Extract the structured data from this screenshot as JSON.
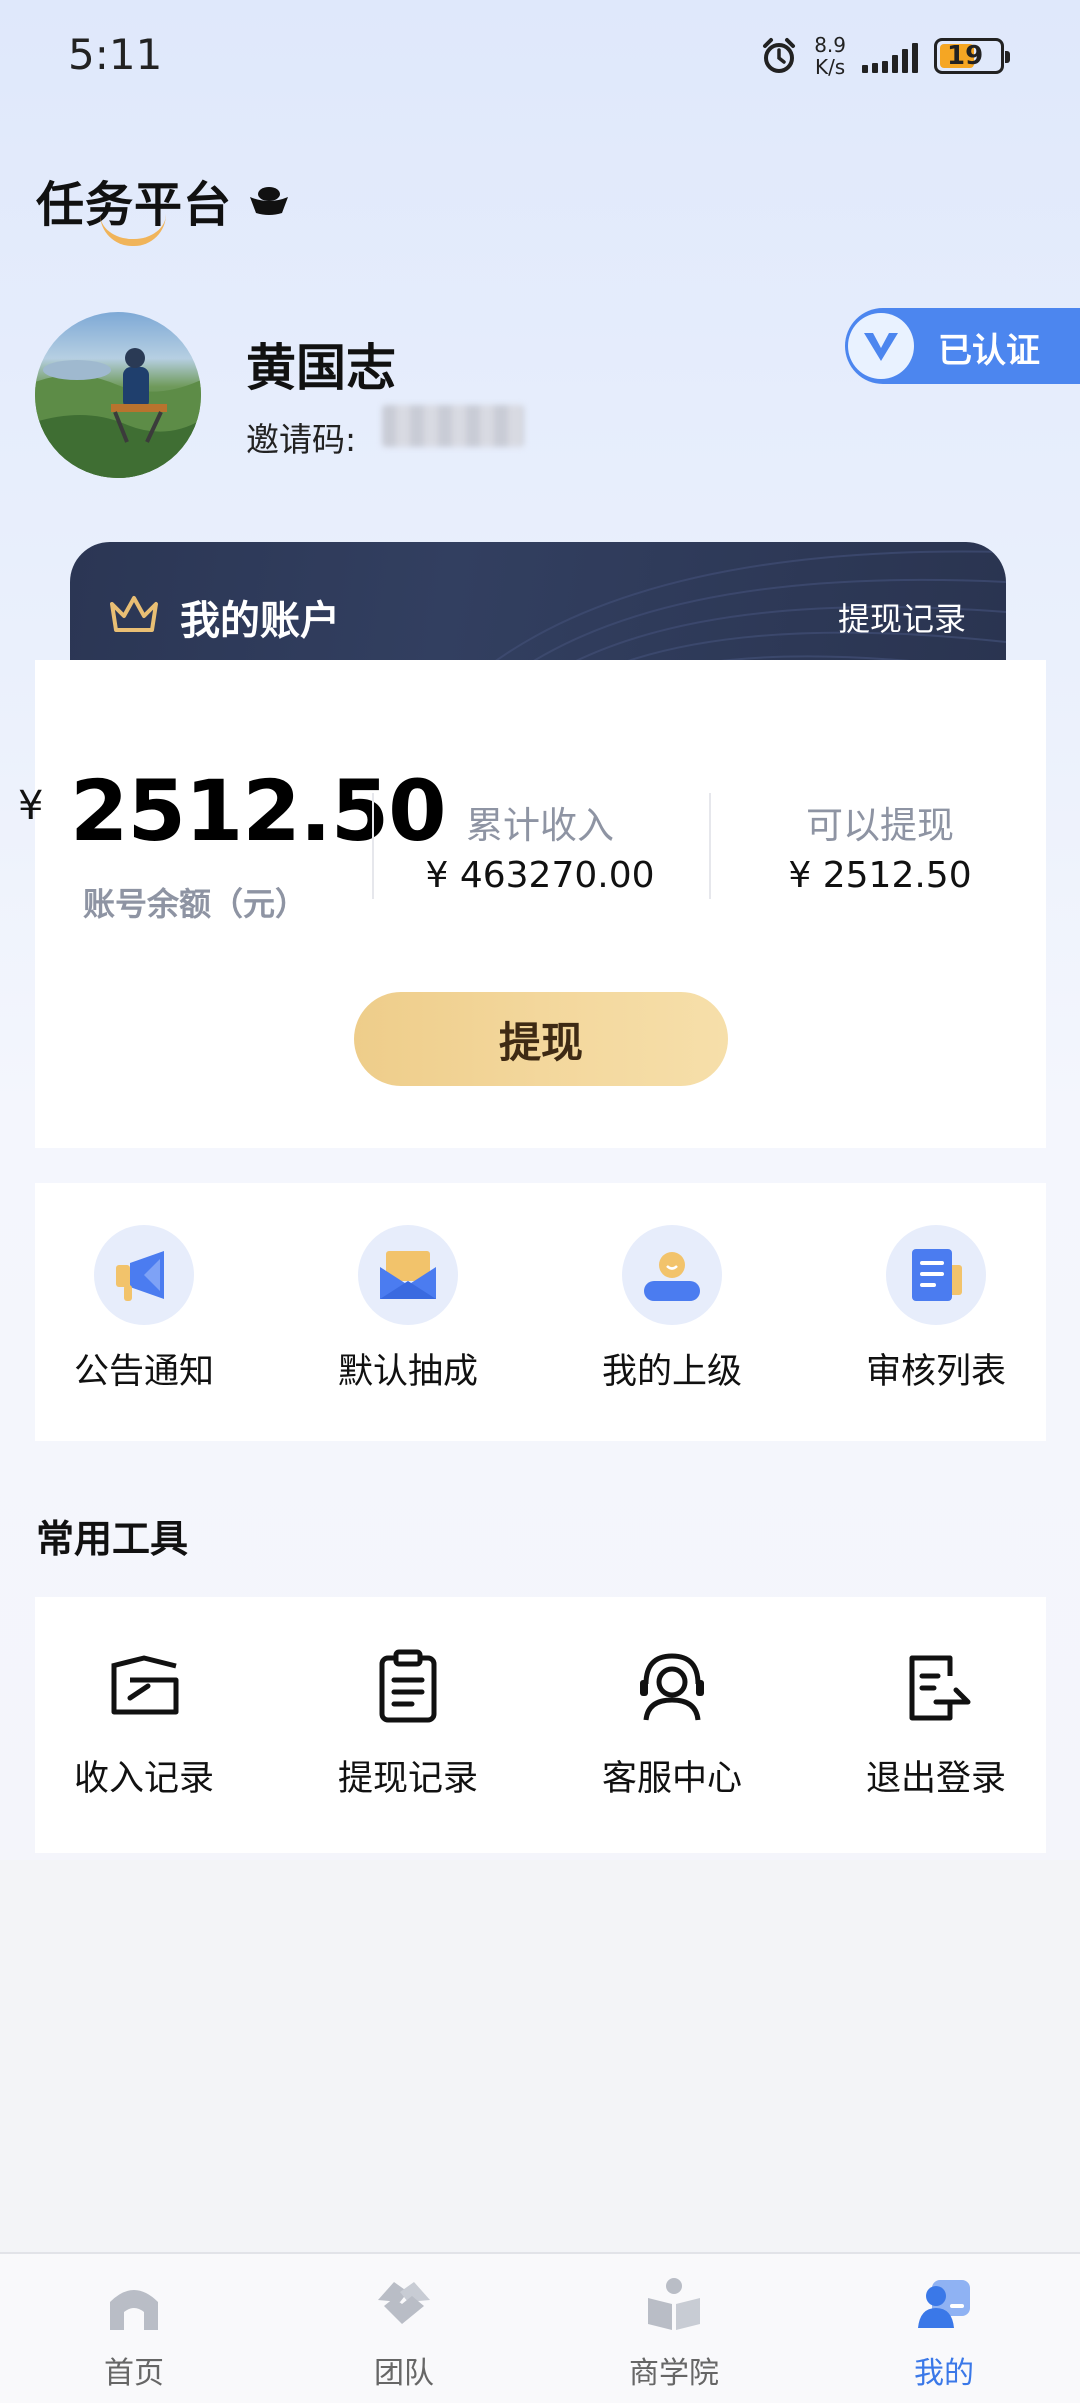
{
  "status_bar": {
    "time": "5:11",
    "net_speed_value": "8.9",
    "net_speed_unit": "K/s",
    "battery": "19",
    "icons": [
      "alarm-icon",
      "signal-icon",
      "battery-icon"
    ]
  },
  "header": {
    "logo_text": "任务平台",
    "logo_icon": "ingot-icon"
  },
  "profile": {
    "name": "黄国志",
    "invite_label": "邀请码:",
    "verified_label": "已认证"
  },
  "account": {
    "title": "我的账户",
    "history_link": "提现记录",
    "currency": "¥",
    "balance": "2512.50",
    "balance_label": "账号余额（元）",
    "total_income_label": "累计收入",
    "total_income_value": "¥ 463270.00",
    "withdrawable_label": "可以提现",
    "withdrawable_value": "¥ 2512.50",
    "withdraw_button": "提现"
  },
  "quick_actions": [
    {
      "label": "公告通知",
      "icon": "megaphone-icon"
    },
    {
      "label": "默认抽成",
      "icon": "envelope-icon"
    },
    {
      "label": "我的上级",
      "icon": "person-icon"
    },
    {
      "label": "审核列表",
      "icon": "document-icon"
    }
  ],
  "tools": {
    "title": "常用工具",
    "items": [
      {
        "label": "收入记录",
        "icon": "income-record-icon"
      },
      {
        "label": "提现记录",
        "icon": "clipboard-icon"
      },
      {
        "label": "客服中心",
        "icon": "customer-service-icon"
      },
      {
        "label": "退出登录",
        "icon": "logout-icon"
      }
    ]
  },
  "bottom_nav": [
    {
      "label": "首页",
      "icon": "home-icon",
      "active": false
    },
    {
      "label": "团队",
      "icon": "team-icon",
      "active": false
    },
    {
      "label": "商学院",
      "icon": "academy-icon",
      "active": false
    },
    {
      "label": "我的",
      "icon": "profile-icon",
      "active": true
    }
  ],
  "colors": {
    "accent": "#3a78e8",
    "account_card_dark": "#2b3654",
    "withdraw_gold": "#eecd8a",
    "verified_blue": "#4c86ef"
  }
}
